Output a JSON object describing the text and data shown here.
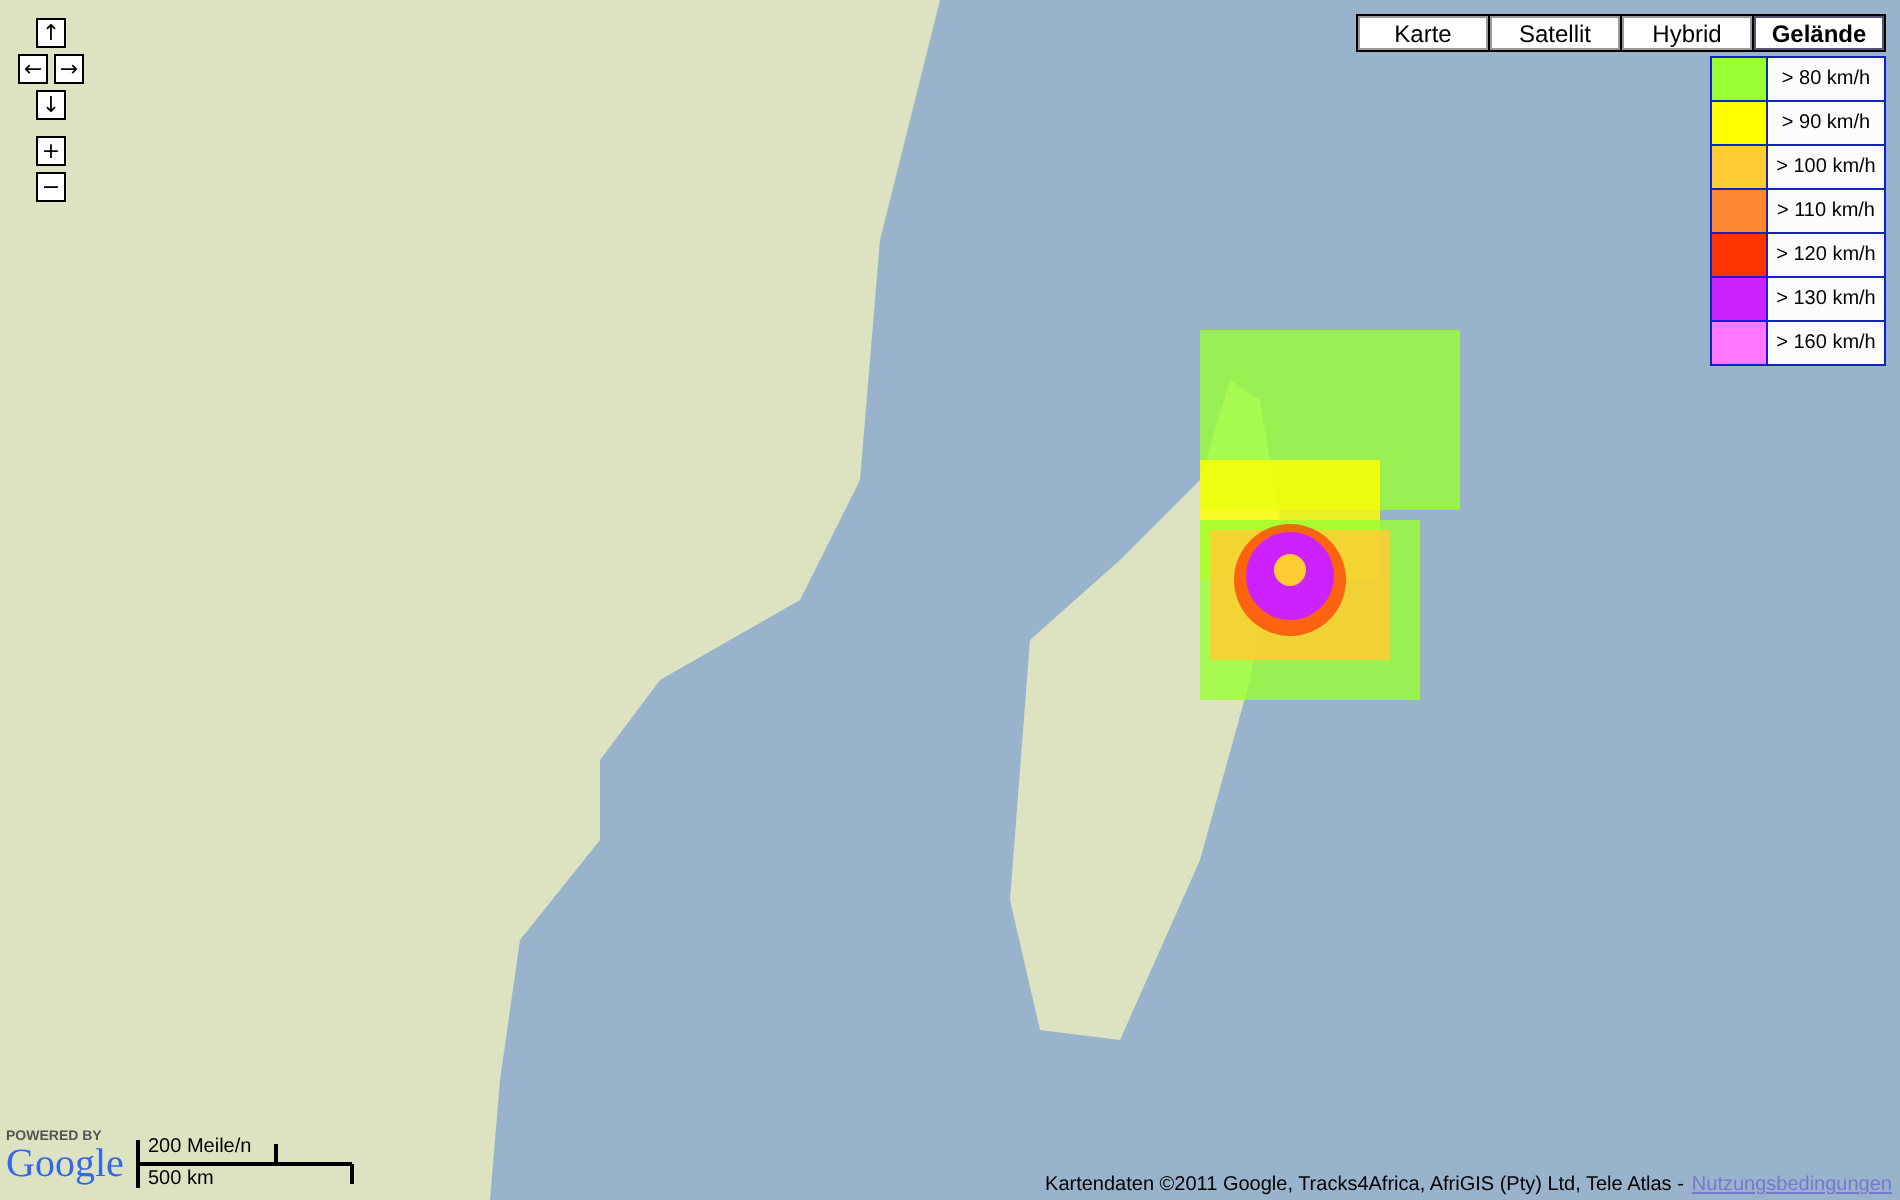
{
  "nav_controls": [
    {
      "label": "↑",
      "kind": "pan"
    },
    {
      "label": "←",
      "kind": "pan"
    },
    {
      "label": "→",
      "kind": "pan"
    },
    {
      "label": "↓",
      "kind": "pan"
    },
    {
      "label": "+",
      "kind": "zoom"
    },
    {
      "label": "−",
      "kind": "zoom"
    }
  ],
  "map_types": [
    {
      "label": "Karte",
      "selected": false
    },
    {
      "label": "Satellit",
      "selected": false
    },
    {
      "label": "Hybrid",
      "selected": false
    },
    {
      "label": "Gelände",
      "selected": true
    }
  ],
  "legend": [
    {
      "label": "> 80 km/h",
      "color": "#99ff33"
    },
    {
      "label": "> 90 km/h",
      "color": "#ffff00"
    },
    {
      "label": "> 100 km/h",
      "color": "#ffcc33"
    },
    {
      "label": "> 110 km/h",
      "color": "#ff8833"
    },
    {
      "label": "> 120 km/h",
      "color": "#ff3300"
    },
    {
      "label": "> 130 km/h",
      "color": "#cc22ff"
    },
    {
      "label": "> 160 km/h",
      "color": "#ff77ff"
    }
  ],
  "logo": {
    "caption": "POWERED BY",
    "name": "Google"
  },
  "scale": {
    "miles": "200 Meile/n",
    "km": "500 km"
  },
  "attribution": {
    "text": "Kartendaten ©2011 Google, Tracks4Africa, AfriGIS (Pty) Ltd, Tele Atlas -",
    "link": "Nutzungsbedingungen"
  }
}
